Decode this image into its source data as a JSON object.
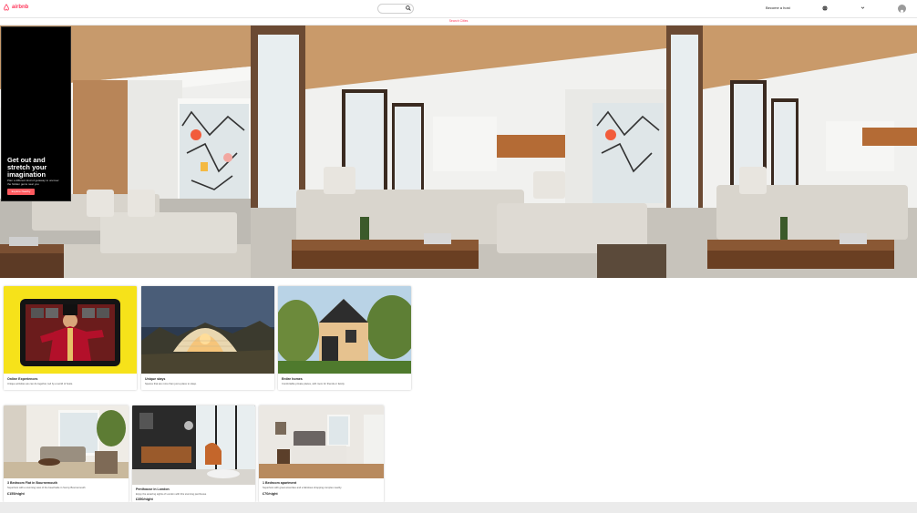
{
  "header": {
    "logo": "airbnb",
    "host_label": "Become a host"
  },
  "subbar": {
    "text": "Search Cities"
  },
  "hero": {
    "title": "Get out and stretch your imagination",
    "subtitle": "Plan a different kind of getaway to uncover the hidden gems near you",
    "button": "Explore Nearby"
  },
  "categories": [
    {
      "title": "Online Experiences",
      "desc": "Unique activities we can do together, led by a world of hosts."
    },
    {
      "title": "Unique stays",
      "desc": "Spaces that are more than just a place to sleep."
    },
    {
      "title": "Entire homes",
      "desc": "Comfortable private places, with room for friends or family."
    }
  ],
  "listings": [
    {
      "title": "3 Bedroom Flat in Bournemouth",
      "desc": "Superhost with a stunning view of the beachside in Sunny Bournemouth",
      "price": "£155/night"
    },
    {
      "title": "Penthouse in London",
      "desc": "Enjoy the amazing sights of London with this stunning penthouse",
      "price": "£350/night"
    },
    {
      "title": "1 Bedroom apartment",
      "desc": "Superhost with great amenities and a fabolous shopping complex nearby",
      "price": "£70/night"
    }
  ],
  "colors": {
    "brand": "#ff385c",
    "button": "#ff5a5f"
  }
}
